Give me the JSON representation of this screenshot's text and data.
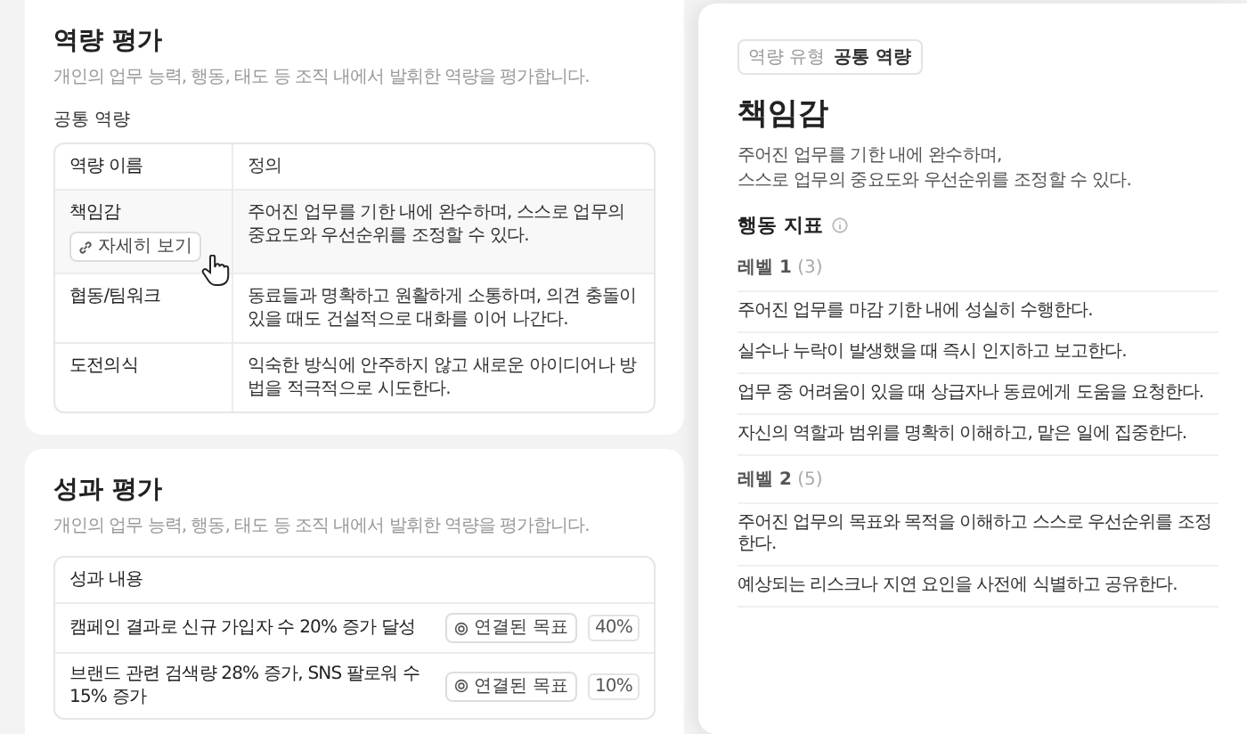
{
  "competency_section": {
    "title": "역량 평가",
    "description": "개인의 업무 능력, 행동, 태도 등 조직 내에서 발휘한 역량을 평가합니다.",
    "group_label": "공통 역량",
    "columns": [
      "역량 이름",
      "정의"
    ],
    "rows": [
      {
        "name": "책임감",
        "detail_button": "자세히 보기",
        "hovered": true,
        "definition": "주어진 업무를 기한 내에 완수하며, 스스로 업무의 중요도와 우선순위를 조정할 수 있다."
      },
      {
        "name": "협동/팀워크",
        "hovered": false,
        "definition": "동료들과 명확하고 원활하게 소통하며, 의견 충돌이 있을 때도 건설적으로 대화를 이어 나간다."
      },
      {
        "name": "도전의식",
        "hovered": false,
        "definition": "익숙한 방식에 안주하지 않고 새로운 아이디어나 방법을 적극적으로 시도한다."
      }
    ]
  },
  "performance_section": {
    "title": "성과 평가",
    "description": "개인의 업무 능력, 행동, 태도 등 조직 내에서 발휘한 역량을 평가합니다.",
    "columns": [
      "성과 내용"
    ],
    "rows": [
      {
        "text": "캠페인 결과로 신규 가입자 수 20% 증가 달성",
        "goal_button": "연결된 목표",
        "weight": "40%"
      },
      {
        "text": "브랜드 관련 검색량 28% 증가, SNS 팔로워 수 15% 증가",
        "goal_button": "연결된 목표",
        "weight": "10%"
      }
    ]
  },
  "drawer": {
    "tag_label": "역량 유형",
    "tag_value": "공통 역량",
    "title": "책임감",
    "description_lines": [
      "주어진 업무를 기한 내에 완수하며,",
      "스스로 업무의 중요도와 우선순위를 조정할 수 있다."
    ],
    "indicators_title": "행동 지표",
    "levels": [
      {
        "label": "레벨 1",
        "count": "(3)",
        "items": [
          "주어진 업무를 마감 기한 내에 성실히 수행한다.",
          "실수나 누락이 발생했을 때 즉시 인지하고 보고한다.",
          "업무 중 어려움이 있을 때 상급자나 동료에게 도움을 요청한다.",
          "자신의 역할과 범위를 명확히 이해하고, 맡은 일에 집중한다."
        ]
      },
      {
        "label": "레벨 2",
        "count": "(5)",
        "items": [
          "주어진 업무의 목표와 목적을 이해하고 스스로 우선순위를 조정한다.",
          "예상되는 리스크나 지연 요인을 사전에 식별하고 공유한다."
        ]
      }
    ]
  }
}
